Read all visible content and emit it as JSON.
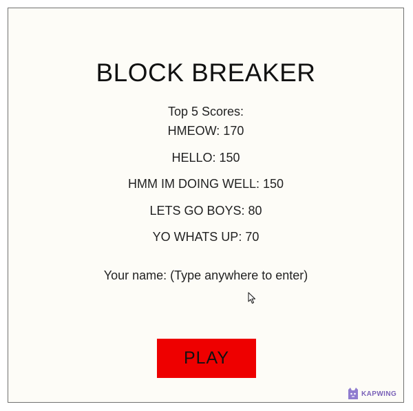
{
  "game": {
    "title": "BLOCK BREAKER",
    "scores_heading": "Top 5 Scores:",
    "scores": [
      "HMEOW: 170",
      "HELLO: 150",
      "HMM IM DOING WELL: 150",
      "LETS GO BOYS: 80",
      "YO WHATS UP: 70"
    ],
    "name_prompt": "Your name: (Type anywhere to enter)",
    "play_label": "PLAY"
  },
  "watermark": {
    "text": "KAPWING"
  },
  "colors": {
    "background": "#fdfcf7",
    "play_button": "#ee0000",
    "watermark": "#7a62b8"
  },
  "icons": {
    "cursor": "mouse-pointer-icon",
    "watermark_logo": "kapwing-logo"
  }
}
